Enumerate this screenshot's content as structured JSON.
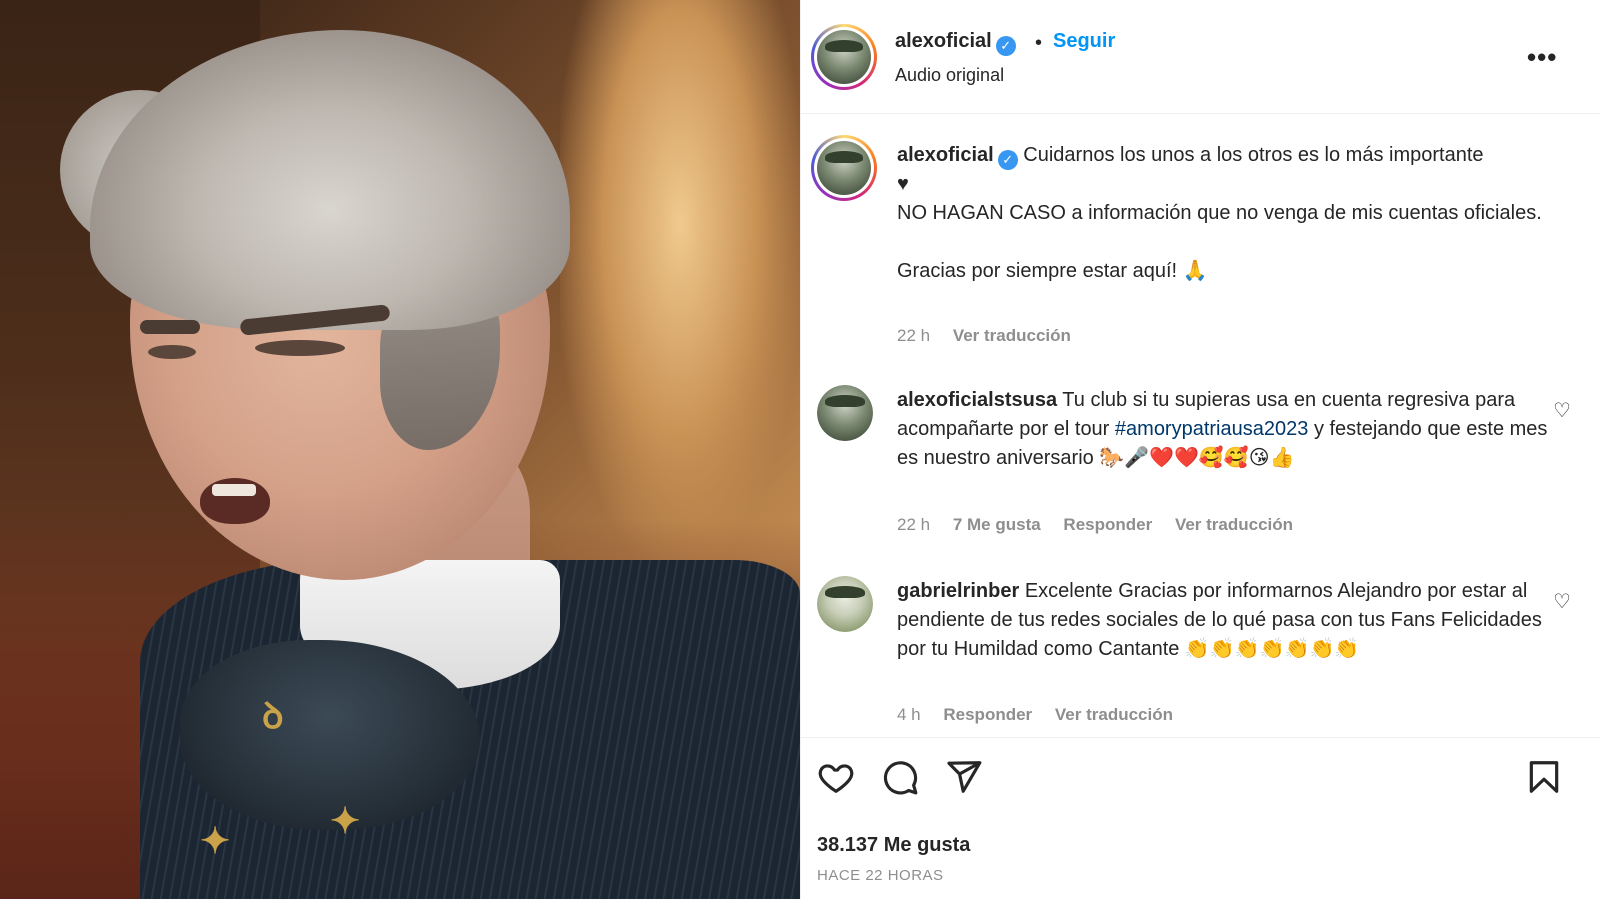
{
  "header": {
    "username": "alexoficial",
    "follow_label": "Seguir",
    "separator": "•",
    "subtitle": "Audio original",
    "more": "•••",
    "verified_mark": "✓"
  },
  "caption": {
    "username": "alexoficial",
    "line1": "Cuidarnos los unos a los otros es lo más importante",
    "line2": "♥",
    "line3": "NO HAGAN CASO a información que no venga de mis cuentas oficiales.",
    "line4": "Gracias por siempre estar aquí! 🙏",
    "time": "22 h",
    "translate": "Ver traducción"
  },
  "comments": [
    {
      "username": "alexoficialstsusa",
      "text_before_tag": "Tu club si tu supieras usa en cuenta regresiva para acompañarte por el tour",
      "tag": "#amorypatriausa2023",
      "text_after_tag": "y festejando que este mes es nuestro aniversario 🐎🎤❤️❤️🥰🥰😘👍",
      "time": "22 h",
      "likes": "7 Me gusta",
      "reply": "Responder",
      "translate": "Ver traducción"
    },
    {
      "username": "gabrielrinber",
      "text": "Excelente Gracias por informarnos Alejandro por estar al pendiente de tus redes sociales de lo qué pasa con tus Fans Felicidades por tu Humildad como Cantante 👏👏👏👏👏👏👏",
      "time": "4 h",
      "reply": "Responder",
      "translate": "Ver traducción"
    }
  ],
  "footer": {
    "likes": "38.137 Me gusta",
    "time": "HACE 22 HORAS"
  },
  "icons": [
    "like-icon",
    "comment-icon",
    "share-icon",
    "save-icon",
    "heart-small-icon",
    "more-icon"
  ],
  "colors": {
    "link_blue": "#0095f6",
    "hashtag": "#00376b",
    "muted": "#8e8e8e",
    "verified": "#3897f0"
  }
}
